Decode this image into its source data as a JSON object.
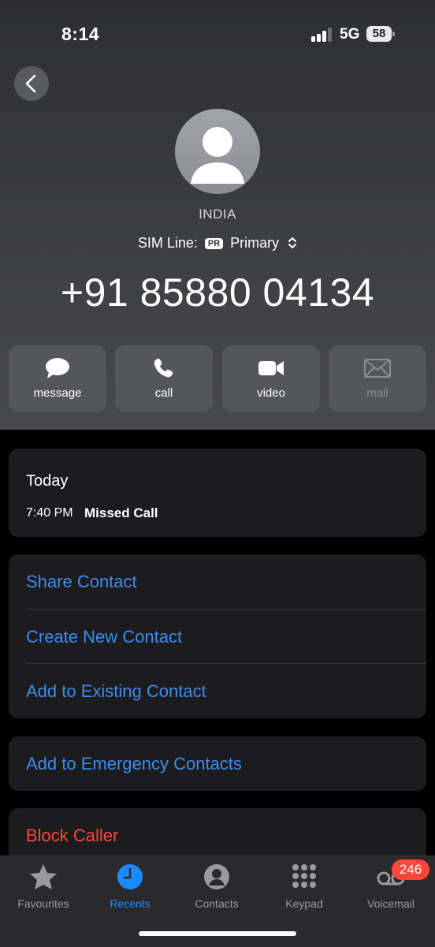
{
  "status_bar": {
    "time": "8:14",
    "network": "5G",
    "battery": "58"
  },
  "contact": {
    "country": "INDIA",
    "sim_label": "SIM Line:",
    "sim_badge": "PR",
    "sim_value": "Primary",
    "number": "+91 85880 04134"
  },
  "actions": [
    {
      "label": "message",
      "icon": "message-bubble-icon"
    },
    {
      "label": "call",
      "icon": "phone-icon"
    },
    {
      "label": "video",
      "icon": "video-camera-icon"
    },
    {
      "label": "mail",
      "icon": "envelope-icon",
      "enabled": false
    }
  ],
  "history": {
    "title": "Today",
    "time": "7:40 PM",
    "type": "Missed Call"
  },
  "contact_options": [
    "Share Contact",
    "Create New Contact",
    "Add to Existing Contact"
  ],
  "emergency_option": "Add to Emergency Contacts",
  "block_option": "Block Caller",
  "tab_bar": {
    "tabs": [
      {
        "label": "Favourites",
        "icon": "star-icon"
      },
      {
        "label": "Recents",
        "icon": "clock-icon",
        "active": true
      },
      {
        "label": "Contacts",
        "icon": "person-circle-icon"
      },
      {
        "label": "Keypad",
        "icon": "keypad-icon"
      },
      {
        "label": "Voicemail",
        "icon": "voicemail-icon"
      }
    ],
    "voicemail_badge": "246"
  },
  "colors": {
    "link": "#3b8cf0",
    "destructive": "#ff453a",
    "active_tab": "#1a8bff",
    "card": "#1c1c1e"
  }
}
